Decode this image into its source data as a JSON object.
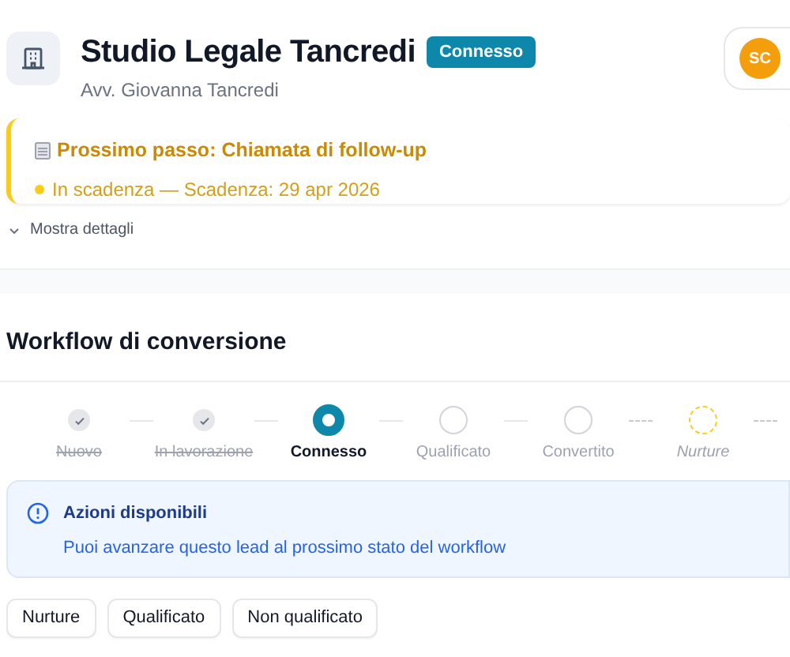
{
  "header": {
    "title": "Studio Legale Tancredi",
    "badge": "Connesso",
    "subtitle": "Avv. Giovanna Tancredi",
    "avatar": "SC"
  },
  "next_step": {
    "title": "Prossimo passo: Chiamata di follow-up",
    "status": "In scadenza — Scadenza: 29 apr 2026"
  },
  "details_toggle": {
    "label": "Mostra dettagli",
    "expanded": false
  },
  "workflow": {
    "title": "Workflow di conversione",
    "steps": [
      {
        "label": "Nuovo",
        "kind": "done"
      },
      {
        "label": "In lavorazione",
        "kind": "done"
      },
      {
        "label": "Connesso",
        "kind": "current"
      },
      {
        "label": "Qualificato",
        "kind": "pending"
      },
      {
        "label": "Convertito",
        "kind": "pending"
      },
      {
        "label": "Nurture",
        "kind": "alt"
      }
    ],
    "info": {
      "title": "Azioni disponibili",
      "message": "Puoi avanzare questo lead al prossimo stato del workflow"
    },
    "actions": [
      "Nurture",
      "Qualificato",
      "Non qualificato"
    ]
  }
}
